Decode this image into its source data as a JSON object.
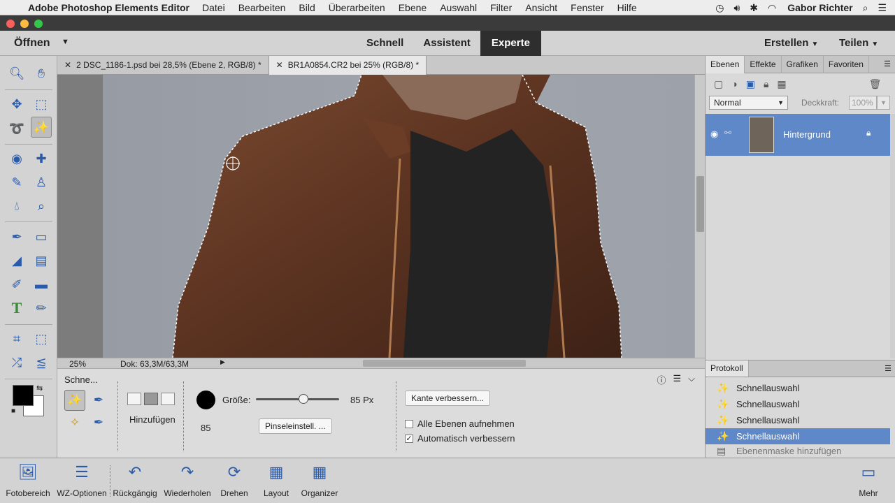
{
  "mac_menu": {
    "app": "Adobe Photoshop Elements Editor",
    "items": [
      "Datei",
      "Bearbeiten",
      "Bild",
      "Überarbeiten",
      "Ebene",
      "Auswahl",
      "Filter",
      "Ansicht",
      "Fenster",
      "Hilfe"
    ],
    "user": "Gabor Richter"
  },
  "topbar": {
    "open": "Öffnen",
    "modes": [
      "Schnell",
      "Assistent",
      "Experte"
    ],
    "active_mode": "Experte",
    "create": "Erstellen",
    "share": "Teilen"
  },
  "doc_tabs": [
    {
      "label": "2 DSC_1186-1.psd bei 28,5% (Ebene 2, RGB/8) *",
      "active": false
    },
    {
      "label": "BR1A0854.CR2 bei 25% (RGB/8) *",
      "active": true
    }
  ],
  "status": {
    "zoom": "25%",
    "doc": "Dok: 63,3M/63,3M"
  },
  "tools": [
    "zoom",
    "hand",
    "move",
    "rectangular-marquee",
    "lasso",
    "quick-selection",
    "red-eye",
    "spot-healing",
    "smart-brush",
    "clone-stamp",
    "blur",
    "sponge",
    "brush",
    "eraser",
    "paint-bucket",
    "gradient",
    "eyedropper",
    "shape",
    "type",
    "pencil",
    "crop",
    "recompose",
    "content-aware-move",
    "straighten"
  ],
  "options": {
    "tool_name": "Schne...",
    "mode_label": "Hinzufügen",
    "size_label": "Größe:",
    "size_value": "85 Px",
    "size_fraction": 0.55,
    "brush_size": "85",
    "brush_settings_button": "Pinseleinstell. ...",
    "refine_edge_button": "Kante verbessern...",
    "sample_all_layers": {
      "label": "Alle Ebenen aufnehmen",
      "checked": false
    },
    "auto_enhance": {
      "label": "Automatisch verbessern",
      "checked": true
    }
  },
  "panel": {
    "tabs": [
      "Ebenen",
      "Effekte",
      "Grafiken",
      "Favoriten"
    ],
    "active_tab": "Ebenen",
    "blend_mode": "Normal",
    "opacity_label": "Deckkraft:",
    "opacity_value": "100%",
    "layer_name": "Hintergrund"
  },
  "history": {
    "tab": "Protokoll",
    "items": [
      {
        "label": "Schnellauswahl",
        "selected": false,
        "dim": false
      },
      {
        "label": "Schnellauswahl",
        "selected": false,
        "dim": false
      },
      {
        "label": "Schnellauswahl",
        "selected": false,
        "dim": false
      },
      {
        "label": "Schnellauswahl",
        "selected": true,
        "dim": false
      },
      {
        "label": "Ebenenmaske hinzufügen",
        "selected": false,
        "dim": true
      }
    ]
  },
  "bottombar": {
    "photo_bin": "Fotobereich",
    "tool_options": "WZ-Optionen",
    "undo": "Rückgängig",
    "redo": "Wiederholen",
    "rotate": "Drehen",
    "layout": "Layout",
    "organizer": "Organizer",
    "more": "Mehr"
  }
}
